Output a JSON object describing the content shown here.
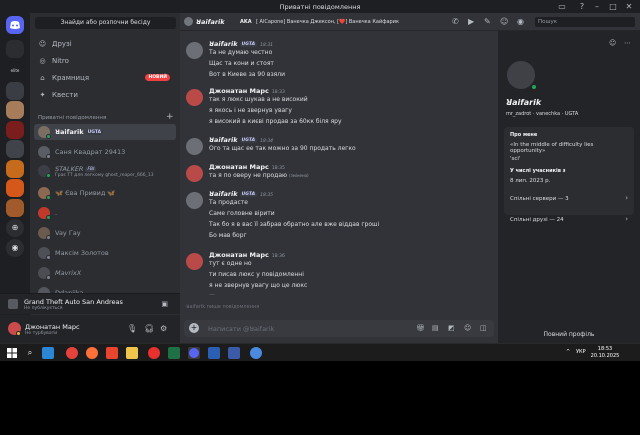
{
  "window": {
    "title": "Приватні повідомлення"
  },
  "sidebar": {
    "search_button": "Знайди або розпочни бесіду",
    "nav": [
      {
        "label": "Друзі",
        "icon": "friends-icon"
      },
      {
        "label": "Nitro",
        "icon": "nitro-icon"
      },
      {
        "label": "Крамниця",
        "icon": "shop-icon",
        "badge": "НОВИЙ"
      },
      {
        "label": "Квести",
        "icon": "quests-icon"
      }
    ],
    "dm_header": "Приватні повідомлення",
    "dms": [
      {
        "name": "ꓤaifarik",
        "tag": "UGTA",
        "status": "online",
        "color": "#7b6f63",
        "active": true
      },
      {
        "name": "Саня Квадрат 29413",
        "status": "offline",
        "color": "#5a5d63"
      },
      {
        "name": "STALKER",
        "tag": "FBI",
        "sub": "Грає TT для легкому ghost_reaper_666_13",
        "status": "online",
        "color": "#3c3e45"
      },
      {
        "name": "🦋 Єва Привид 🦋",
        "status": "online",
        "color": "#8c6a52"
      },
      {
        "name": ".",
        "status": "online",
        "color": "#c0392b"
      },
      {
        "name": "Vay Гау",
        "status": "offline",
        "color": "#6b5b4e"
      },
      {
        "name": "Максім Золотов",
        "status": "offline",
        "color": "#4e5058"
      },
      {
        "name": "MavrixX",
        "status": "offline",
        "color": "#4b4d53"
      },
      {
        "name": "Ddanijka",
        "status": "offline",
        "color": "#55575e"
      }
    ]
  },
  "activity": {
    "game": "Grand Theft Auto San Andreas",
    "sub": "Не публікується"
  },
  "user": {
    "name": "Джонатан Марс",
    "status": "Не турбувати"
  },
  "chat": {
    "header_name": "ꓤaifarik",
    "aka_label": "AKA",
    "aka_value": "[ AlCapone] Ванечка Джексон, [❤️] Ванечка Кайфарик",
    "search_placeholder": "Пошук",
    "messages": [
      {
        "author": "ꓤaifarik",
        "tag": "UGTA",
        "time": "18:31",
        "color": "#f2f3f5",
        "avatar": "#6c6f75",
        "lines": [
          "Та не думаю честно",
          "Щас та кони и стоят",
          "Вот в Киеве за 90 взяли"
        ]
      },
      {
        "author": "Джонатан Марс",
        "time": "18:33",
        "color": "#f2f3f5",
        "avatar": "#b94a48",
        "lines": [
          "так я люкс шукав а не високий",
          "я якось і не звернув увагу",
          "я високий в києві продав за 60кк біля яру"
        ]
      },
      {
        "author": "ꓤaifarik",
        "tag": "UGTA",
        "time": "18:34",
        "color": "#f2f3f5",
        "avatar": "#6c6f75",
        "lines": [
          "Ого та щас ее так можно за 90 продать легко"
        ]
      },
      {
        "author": "Джонатан Марс",
        "time": "18:35",
        "color": "#f2f3f5",
        "avatar": "#b94a48",
        "lines": [
          "та я по оверу не продаю"
        ],
        "edited": "(змінено)"
      },
      {
        "author": "ꓤaifarik",
        "tag": "UGTA",
        "time": "18:35",
        "color": "#f2f3f5",
        "avatar": "#6c6f75",
        "lines": [
          "Та продасте",
          "Саме головне вірити",
          "Так бо я в вас її забрав обратно але вже віддав гроші",
          "Бо мав борг"
        ]
      },
      {
        "author": "Джонатан Марс",
        "time": "18:36",
        "color": "#f2f3f5",
        "avatar": "#b94a48",
        "lines": [
          "тут є одне но",
          "ти писав люкс у повідомленні",
          "я не звернув увагу що це люкс"
        ]
      }
    ],
    "divider_text": "—",
    "typing": "ꓤaifarik  пише повідомлення",
    "composer_placeholder": "Написати @ꓤaifarik"
  },
  "profile": {
    "name": "ꓤaifarik",
    "handle": "mr_zadrot · ᴠanechka · UGTA",
    "about_title": "Про мене",
    "about_text": "«In the middle of difficulty lies opportunity»",
    "about_author": "'sci'",
    "member_title": "У числі учасників з",
    "member_since": "8 лип. 2023 р.",
    "mutual_servers": "Спільні сервери — 3",
    "mutual_friends": "Спільні друзі — 24",
    "full_profile": "Повний профіль"
  },
  "taskbar": {
    "lang": "УКР",
    "time": "18:53",
    "date": "20.10.2025"
  }
}
